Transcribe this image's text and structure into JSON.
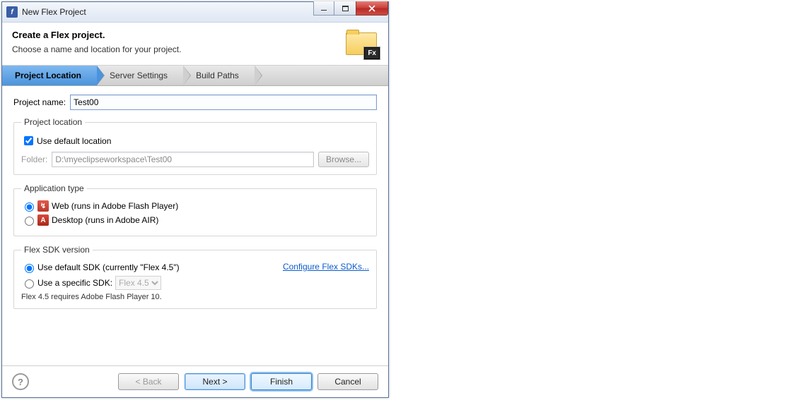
{
  "window": {
    "title": "New Flex Project"
  },
  "header": {
    "title": "Create a Flex project.",
    "subtitle": "Choose a name and location for your project.",
    "badge": "Fx"
  },
  "crumbs": {
    "items": [
      {
        "label": "Project Location"
      },
      {
        "label": "Server Settings"
      },
      {
        "label": "Build Paths"
      }
    ]
  },
  "project": {
    "name_label": "Project name:",
    "name_value": "Test00"
  },
  "location": {
    "legend": "Project location",
    "use_default_label": "Use default location",
    "folder_label": "Folder:",
    "folder_value": "D:\\myeclipseworkspace\\Test00",
    "browse_label": "Browse..."
  },
  "apptype": {
    "legend": "Application type",
    "web_label": "Web (runs in Adobe Flash Player)",
    "desktop_label": "Desktop (runs in Adobe AIR)"
  },
  "sdk": {
    "legend": "Flex SDK version",
    "default_label": "Use default SDK (currently \"Flex 4.5\")",
    "specific_label": "Use a specific SDK:",
    "specific_value": "Flex 4.5",
    "configure_link": "Configure Flex SDKs...",
    "note": "Flex 4.5 requires Adobe Flash Player 10."
  },
  "buttons": {
    "back": "< Back",
    "next": "Next >",
    "finish": "Finish",
    "cancel": "Cancel"
  }
}
